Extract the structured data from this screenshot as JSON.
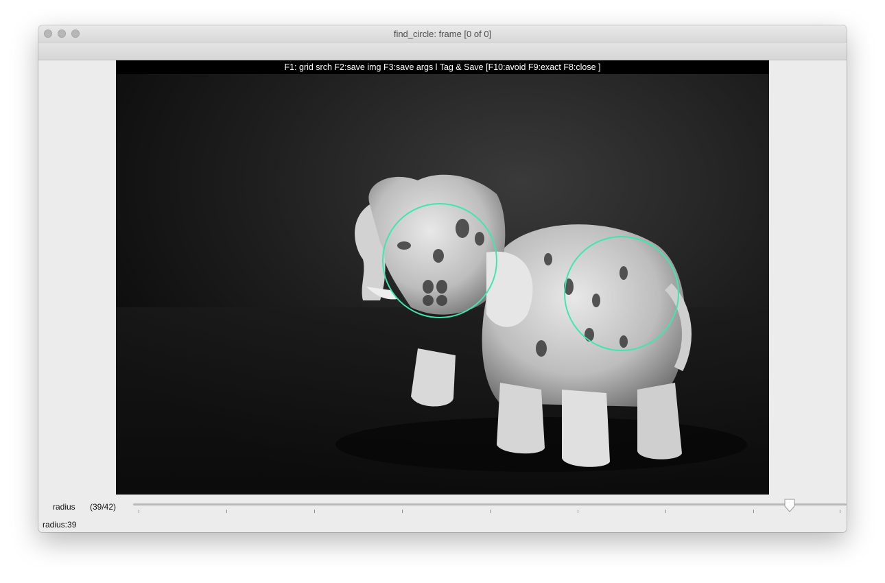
{
  "window": {
    "title": "find_circle: frame [0 of 0]"
  },
  "hotkeys": "F1: grid srch F2:save img F3:save args l Tag & Save [F10:avoid F9:exact F8:close ]",
  "image": {
    "description_icon": "elephant-figurine-photo"
  },
  "overlay": {
    "circle_color": "#3fe6ad"
  },
  "trackbar": {
    "name": "radius",
    "count_text": "(39/42)",
    "value": 39,
    "max": 42
  },
  "status": "radius:39"
}
